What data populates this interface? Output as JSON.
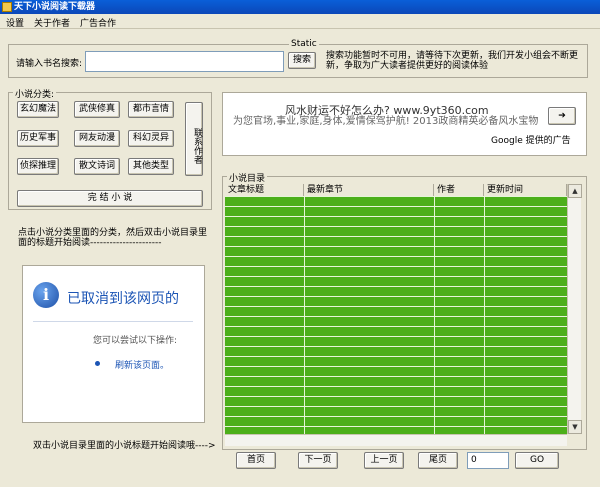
{
  "window": {
    "title": "天下小说阅读下载器"
  },
  "menu": [
    "设置",
    "关于作者",
    "广告合作"
  ],
  "search": {
    "static_label": "Static",
    "label": "请输入书名搜索:",
    "value": "",
    "button": "搜索",
    "notice": "搜索功能暂时不可用，请等待下次更新，我们开发小组会不断更新，争取为广大读者提供更好的阅读体验"
  },
  "categories": {
    "title": "小说分类:",
    "items": [
      "玄幻魔法",
      "武侠修真",
      "都市言情",
      "历史军事",
      "网友动漫",
      "科幻灵异",
      "侦探推理",
      "散文诗词",
      "其他类型"
    ],
    "contact_button": "联系作者",
    "complete_button": "完 结 小 说"
  },
  "hint_top": "点击小说分类里面的分类，然后双击小说目录里面的标题开始阅读----------------------",
  "browser_error": {
    "title": "已取消到该网页的",
    "subtitle": "您可以尝试以下操作:",
    "link": "刷新该页面。"
  },
  "hint_bottom": "双击小说目录里面的小说标题开始阅读哦---->",
  "ad": {
    "headline": "风水财运不好怎么办? www.9yt360.com",
    "body": "为您官场,事业,家庭,身体,爱情保驾护航! 2013政商精英必备风水宝物",
    "provider": "Google 提供的广告"
  },
  "catalog": {
    "title": "小说目录",
    "columns": [
      "文章标题",
      "最新章节",
      "作者",
      "更新时间"
    ],
    "rows": []
  },
  "pager": {
    "first": "首页",
    "prev": "下一页",
    "next": "上一页",
    "last": "尾页",
    "page_value": "0",
    "go": "GO"
  }
}
